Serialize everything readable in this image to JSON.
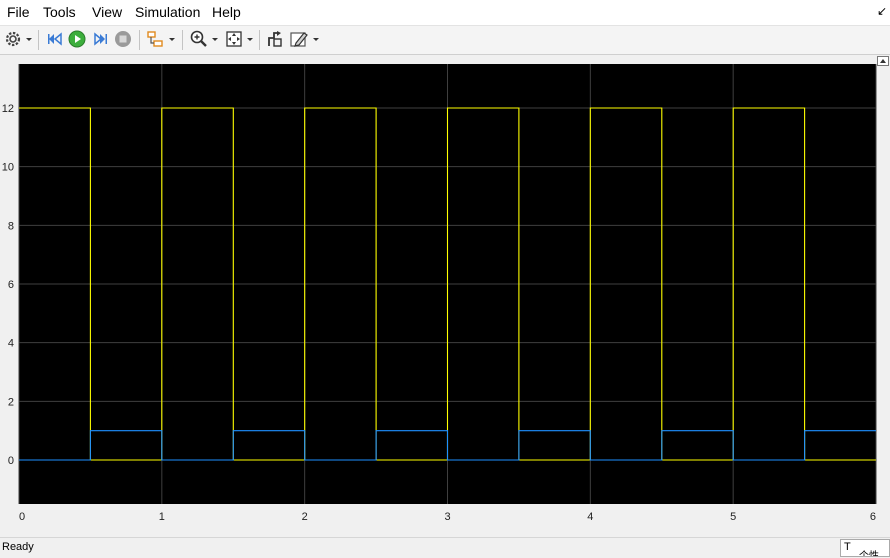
{
  "menu": {
    "items": [
      "File",
      "Tools",
      "View",
      "Simulation",
      "Help"
    ],
    "corner_icon": "dock-arrow-icon"
  },
  "toolbar": {
    "icons": [
      "gear-icon",
      "step-back-icon",
      "run-icon",
      "step-forward-icon",
      "stop-icon",
      "highlight-block-icon",
      "zoom-in-icon",
      "fit-view-icon",
      "restore-view-icon",
      "style-icon"
    ],
    "colors": {
      "run": "#3cae3c",
      "stop": "#9a9a9a"
    }
  },
  "status": {
    "text": "Ready",
    "ime_text": "T",
    "ime_sub": "个性"
  },
  "colors": {
    "plot_bg": "#000000",
    "grid": "#3f3f3f",
    "axis_text": "#ffffff",
    "series1": "#ffff00",
    "series2": "#1e90ff"
  },
  "chart_data": {
    "type": "line",
    "step": true,
    "grid": true,
    "xlim": [
      0,
      6
    ],
    "ylim": [
      -1.5,
      13.5
    ],
    "xticks": [
      0,
      1,
      2,
      3,
      4,
      5,
      6
    ],
    "yticks": [
      0,
      2,
      4,
      6,
      8,
      10,
      12
    ],
    "series": [
      {
        "color": "#ffff00",
        "x": [
          0,
          0.5,
          0.5,
          1,
          1,
          1.5,
          1.5,
          2,
          2,
          2.5,
          2.5,
          3,
          3,
          3.5,
          3.5,
          4,
          4,
          4.5,
          4.5,
          5,
          5,
          5.5,
          5.5,
          6
        ],
        "y": [
          12,
          12,
          0,
          0,
          12,
          12,
          0,
          0,
          12,
          12,
          0,
          0,
          12,
          12,
          0,
          0,
          12,
          12,
          0,
          0,
          12,
          12,
          0,
          0
        ]
      },
      {
        "color": "#1e90ff",
        "x": [
          0,
          0.5,
          0.5,
          1,
          1,
          1.5,
          1.5,
          2,
          2,
          2.5,
          2.5,
          3,
          3,
          3.5,
          3.5,
          4,
          4,
          4.5,
          4.5,
          5,
          5,
          5.5,
          5.5,
          6
        ],
        "y": [
          0,
          0,
          1,
          1,
          0,
          0,
          1,
          1,
          0,
          0,
          1,
          1,
          0,
          0,
          1,
          1,
          0,
          0,
          1,
          1,
          0,
          0,
          1,
          1
        ]
      }
    ]
  }
}
